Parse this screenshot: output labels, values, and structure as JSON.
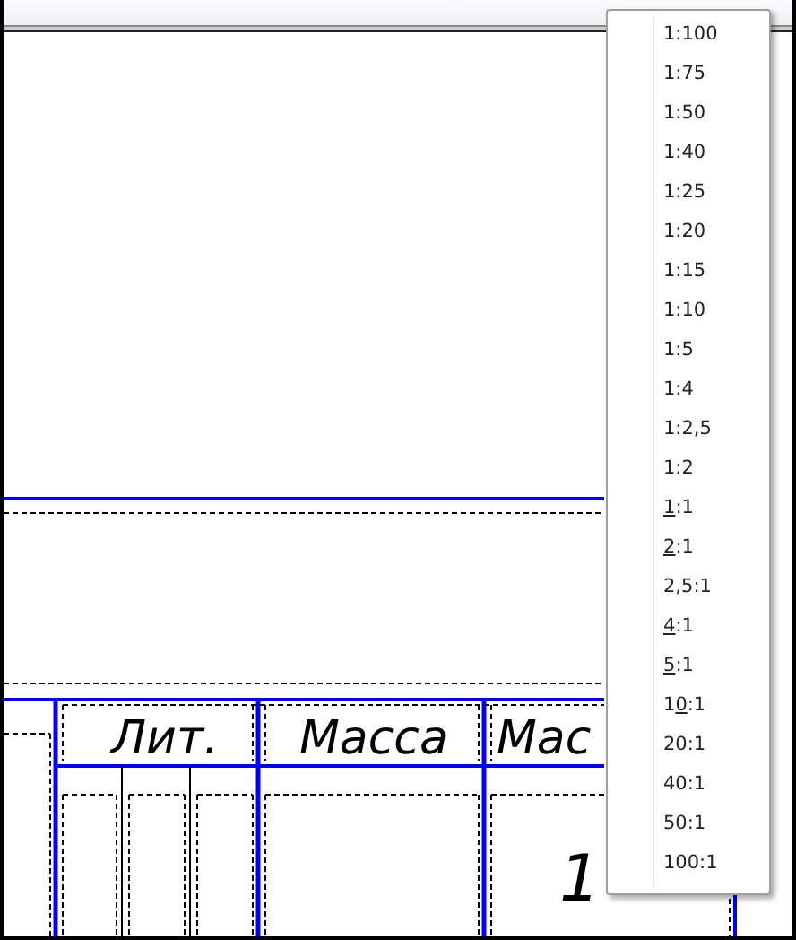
{
  "title_block": {
    "headers": [
      "Лит.",
      "Масса",
      "Мас"
    ],
    "scale_value": "1"
  },
  "scale_menu": {
    "items": [
      {
        "label": "1:100"
      },
      {
        "label": "1:75"
      },
      {
        "label": "1:50"
      },
      {
        "label": "1:40"
      },
      {
        "label": "1:25"
      },
      {
        "label": "1:20"
      },
      {
        "label": "1:15"
      },
      {
        "label": "1:10"
      },
      {
        "label": "1:5"
      },
      {
        "label": "1:4"
      },
      {
        "label": "1:2,5"
      },
      {
        "label": "1:2"
      },
      {
        "access_key": "1",
        "rest": ":1"
      },
      {
        "access_key": "2",
        "rest": ":1"
      },
      {
        "label": "2,5:1"
      },
      {
        "access_key": "4",
        "rest": ":1"
      },
      {
        "access_key": "5",
        "rest": ":1"
      },
      {
        "prefix": "1",
        "access_key": "0",
        "rest": ":1"
      },
      {
        "label": "20:1"
      },
      {
        "label": "40:1"
      },
      {
        "label": "50:1"
      },
      {
        "label": "100:1"
      }
    ]
  }
}
